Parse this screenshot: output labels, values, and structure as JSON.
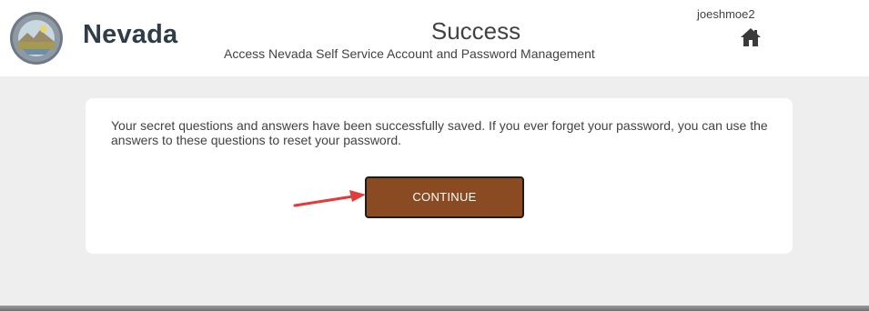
{
  "header": {
    "state_name": "Nevada",
    "title": "Success",
    "subtitle": "Access Nevada Self Service Account and Password Management",
    "username": "joeshmoe2",
    "home_icon": "home-icon"
  },
  "card": {
    "message": "Your secret questions and answers have been successfully saved. If you ever forget your password, you can use the answers to these questions to reset your password.",
    "continue_label": "CONTINUE"
  },
  "colors": {
    "button_bg": "#8a4a22",
    "arrow": "#e03c3c",
    "page_bg": "#eeeeee"
  }
}
